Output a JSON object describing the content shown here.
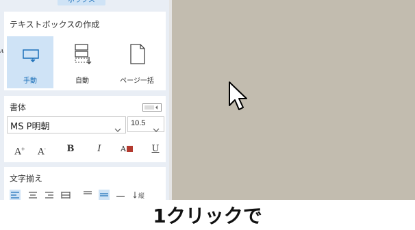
{
  "top_tab": {
    "label": "ボックス"
  },
  "textbox_section": {
    "title": "テキストボックスの作成",
    "buttons": [
      {
        "label": "手動",
        "icon": "textbox-manual-icon",
        "active": true
      },
      {
        "label": "自動",
        "icon": "textbox-auto-icon",
        "active": false
      },
      {
        "label": "ページ一括",
        "icon": "page-batch-icon",
        "active": false
      }
    ]
  },
  "font_section": {
    "title": "書体",
    "font_name": "MS P明朝",
    "font_size": "10.5",
    "format_buttons": [
      "A",
      "A",
      "B",
      "I",
      "A",
      "U"
    ]
  },
  "align_section": {
    "title": "文字揃え"
  },
  "caption": {
    "text": "1クリックで"
  },
  "colors": {
    "accent": "#1b6fb8",
    "active_bg": "#cfe3f6",
    "canvas": "#c2bcaf",
    "font_color_swatch": "#b33a2f"
  }
}
